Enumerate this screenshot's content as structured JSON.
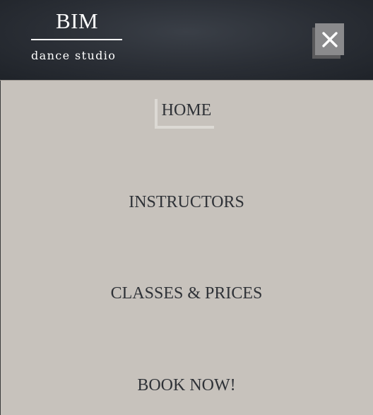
{
  "header": {
    "logo_title": "BIM",
    "logo_subtitle": "dance studio",
    "close_icon": "close-x-icon"
  },
  "nav": {
    "items": [
      {
        "label": "HOME",
        "active": true
      },
      {
        "label": "INSTRUCTORS",
        "active": false
      },
      {
        "label": "CLASSES & PRICES",
        "active": false
      },
      {
        "label": "BOOK NOW!",
        "active": false
      }
    ]
  },
  "colors": {
    "header_bg": "#2a2e35",
    "menu_bg": "#c7c2bc",
    "text": "#2f3237",
    "close_button": "#8a8a8c"
  }
}
